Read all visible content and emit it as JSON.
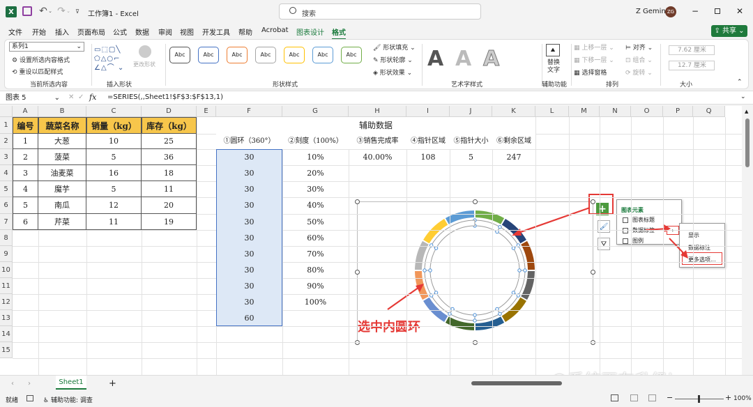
{
  "titlebar": {
    "file_name": "工作簿1",
    "app_name": "Excel",
    "separator": "-",
    "search_placeholder": "搜索",
    "user_name": "Z Gemini",
    "avatar_initials": "ZG"
  },
  "tabs": [
    "文件",
    "开始",
    "插入",
    "页面布局",
    "公式",
    "数据",
    "审阅",
    "视图",
    "开发工具",
    "帮助",
    "Acrobat",
    "图表设计",
    "格式"
  ],
  "active_tab": "格式",
  "share_label": "共享",
  "ribbon": {
    "current_selection": {
      "dropdown_value": "系列1",
      "format_selection": "设置所选内容格式",
      "reset_style": "重设以匹配样式",
      "group": "当前所选内容"
    },
    "insert_shapes": {
      "change_shape": "更改形状",
      "group": "插入形状"
    },
    "shape_styles": {
      "style_label": "Abc",
      "fill": "形状填充",
      "outline": "形状轮廓",
      "effects": "形状效果",
      "group": "形状样式"
    },
    "wordart": {
      "letter": "A",
      "group": "艺术字样式"
    },
    "accessibility": {
      "alt_text_1": "替换",
      "alt_text_2": "文字",
      "group": "辅助功能"
    },
    "arrange": {
      "bring_forward": "上移一层",
      "send_backward": "下移一层",
      "selection_pane": "选择窗格",
      "align": "对齐",
      "group_btn": "组合",
      "rotate": "旋转",
      "group": "排列"
    },
    "size": {
      "height": "7.62 厘米",
      "width": "12.7 厘米",
      "group": "大小"
    }
  },
  "formula_bar": {
    "name_box": "图表 5",
    "fx": "fx",
    "formula": "=SERIES(,,Sheet1!$F$3:$F$13,1)"
  },
  "columns": [
    "A",
    "B",
    "C",
    "D",
    "E",
    "F",
    "G",
    "H",
    "I",
    "J",
    "K",
    "L",
    "M",
    "N",
    "O",
    "P",
    "Q"
  ],
  "rows": [
    "1",
    "2",
    "3",
    "4",
    "5",
    "6",
    "7",
    "8",
    "9",
    "10",
    "11",
    "12",
    "13",
    "14",
    "15"
  ],
  "table": {
    "headers": [
      "编号",
      "蔬菜名称",
      "销量（kg）",
      "库存（kg）"
    ],
    "rows": [
      [
        "1",
        "大葱",
        "10",
        "25"
      ],
      [
        "2",
        "菠菜",
        "5",
        "36"
      ],
      [
        "3",
        "油麦菜",
        "16",
        "18"
      ],
      [
        "4",
        "魔芋",
        "5",
        "11"
      ],
      [
        "5",
        "南瓜",
        "12",
        "20"
      ],
      [
        "6",
        "芹菜",
        "11",
        "19"
      ]
    ]
  },
  "aux": {
    "title": "辅助数据",
    "headers": [
      "①圆环（360°）",
      "②刻度（100%）",
      "③销售完成率",
      "④指针区域",
      "⑤指针大小",
      "⑥剩余区域"
    ],
    "ring": [
      "30",
      "30",
      "30",
      "30",
      "30",
      "30",
      "30",
      "30",
      "30",
      "30",
      "60"
    ],
    "scale": [
      "10%",
      "20%",
      "30%",
      "40%",
      "50%",
      "60%",
      "70%",
      "80%",
      "90%",
      "100%"
    ],
    "completion": "40.00%",
    "pointer_area": "108",
    "pointer_size": "5",
    "remaining": "247"
  },
  "chart_elements_menu": {
    "title": "图表元素",
    "items": [
      "图表标题",
      "数据标签",
      "图例"
    ]
  },
  "submenu": {
    "items": [
      "显示",
      "数据标注",
      "更多选项..."
    ]
  },
  "annotation": "选中内圆环",
  "outer_ring_colors": [
    "#70ad47",
    "#264478",
    "#9e480e",
    "#636363",
    "#997300",
    "#255e91",
    "#43682b",
    "#698ed0",
    "#f1975a",
    "#b7b7b7",
    "#ffcd33",
    "#5b9bd5"
  ],
  "sheet_tab": "Sheet1",
  "status": {
    "ready": "就绪",
    "accessibility": "辅助功能: 调查",
    "zoom": "100%"
  },
  "watermark": "@系统正在升级ing"
}
